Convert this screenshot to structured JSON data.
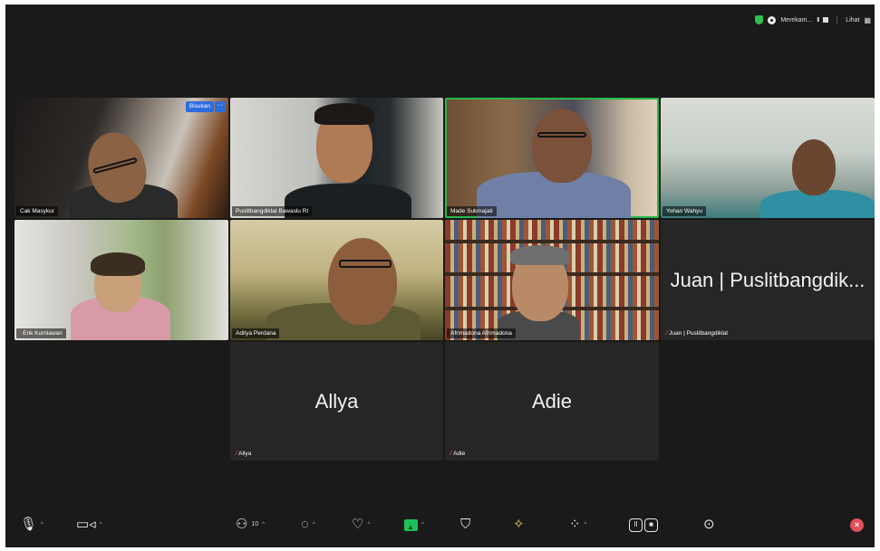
{
  "topbar": {
    "recording_label": "Merekam...",
    "pause_glyph": "II",
    "view_label": "Lihat",
    "view_icon_glyph": "▦"
  },
  "tiles": {
    "cak": {
      "name": "Cak Masykur",
      "pin_label": "Bisukan",
      "more_glyph": "···"
    },
    "pus": {
      "name": "Puslitbangdiklat Bawaslu RI"
    },
    "made": {
      "name": "Made Sukmajati"
    },
    "yohan": {
      "name": "Yohan Wahyu"
    },
    "erik": {
      "name": "Erik Kurniawan"
    },
    "adit": {
      "name": "Aditya Perdana"
    },
    "afri": {
      "name": "Afrimadona Afrimadona"
    },
    "juan": {
      "big_name": "Juan | Puslitbangdik...",
      "name": "Juan | Puslitbangdiklat"
    },
    "allya": {
      "big_name": "Allya",
      "name": "Allya"
    },
    "adie": {
      "big_name": "Adie",
      "name": "Adie"
    }
  },
  "toolbar": {
    "participants_count": "10",
    "icons": {
      "audio": "microphone-icon",
      "video": "video-camera-icon",
      "participants": "participants-icon",
      "chat": "chat-icon",
      "react": "heart-icon",
      "share": "share-screen-icon",
      "security": "shield-icon",
      "ai": "sparkle-icon",
      "apps": "apps-icon",
      "record": "pause-stop-recording-icon",
      "more": "more-icon",
      "end": "end-meeting-icon"
    }
  },
  "colors": {
    "active_speaker": "#27b94a",
    "mic_off": "#e34747",
    "pin_blue": "#2d6cdf",
    "share_green": "#1fbf5a",
    "end_red": "#e0525a"
  }
}
